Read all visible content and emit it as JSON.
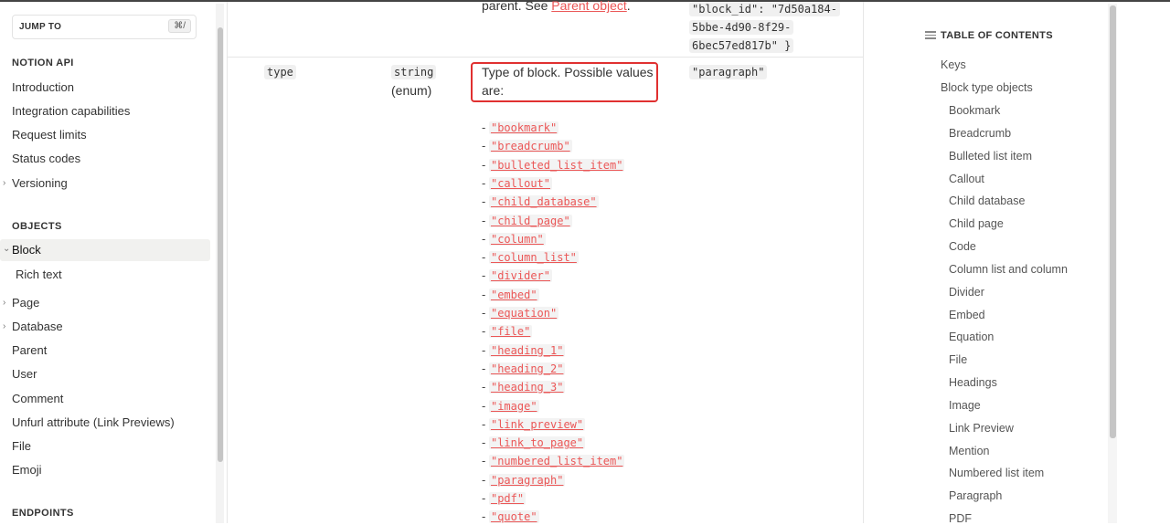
{
  "sidebar": {
    "jump_label": "JUMP TO",
    "jump_shortcut": "⌘/",
    "sections": [
      {
        "title": "NOTION API"
      },
      {
        "title": "OBJECTS"
      },
      {
        "title": "ENDPOINTS"
      }
    ],
    "api_items": [
      "Introduction",
      "Integration capabilities",
      "Request limits",
      "Status codes",
      "Versioning"
    ],
    "object_items": [
      "Block",
      "Rich text",
      "Page",
      "Database",
      "Parent",
      "User",
      "Comment",
      "Unfurl attribute (Link Previews)",
      "File",
      "Emoji"
    ]
  },
  "table": {
    "prev_row": {
      "desc_prefix": "parent. See ",
      "desc_link": "Parent object",
      "desc_suffix": ".",
      "example_lines": [
        "\"block_id\": \"7d50a184-",
        "5bbe-4d90-8f29-",
        "6bec57ed817b\" }"
      ]
    },
    "row": {
      "property": "type",
      "type_code": "string",
      "type_suffix": "(enum)",
      "description_line1": "Type of block. Possible values",
      "description_line2": "are:",
      "example": "\"paragraph\"",
      "enum_values": [
        "\"bookmark\"",
        "\"breadcrumb\"",
        "\"bulleted_list_item\"",
        "\"callout\"",
        "\"child_database\"",
        "\"child_page\"",
        "\"column\"",
        "\"column_list\"",
        "\"divider\"",
        "\"embed\"",
        "\"equation\"",
        "\"file\"",
        "\"heading_1\"",
        "\"heading_2\"",
        "\"heading_3\"",
        "\"image\"",
        "\"link_preview\"",
        "\"link_to_page\"",
        "\"numbered_list_item\"",
        "\"paragraph\"",
        "\"pdf\"",
        "\"quote\""
      ],
      "enum_dash": "-"
    }
  },
  "toc": {
    "title": "TABLE OF CONTENTS",
    "items": [
      "Keys",
      "Block type objects",
      "Bookmark",
      "Breadcrumb",
      "Bulleted list item",
      "Callout",
      "Child database",
      "Child page",
      "Code",
      "Column list and column",
      "Divider",
      "Embed",
      "Equation",
      "File",
      "Headings",
      "Image",
      "Link Preview",
      "Mention",
      "Numbered list item",
      "Paragraph",
      "PDF"
    ]
  },
  "colors": {
    "accent_red": "#eb5757",
    "highlight_box": "#e03030"
  }
}
